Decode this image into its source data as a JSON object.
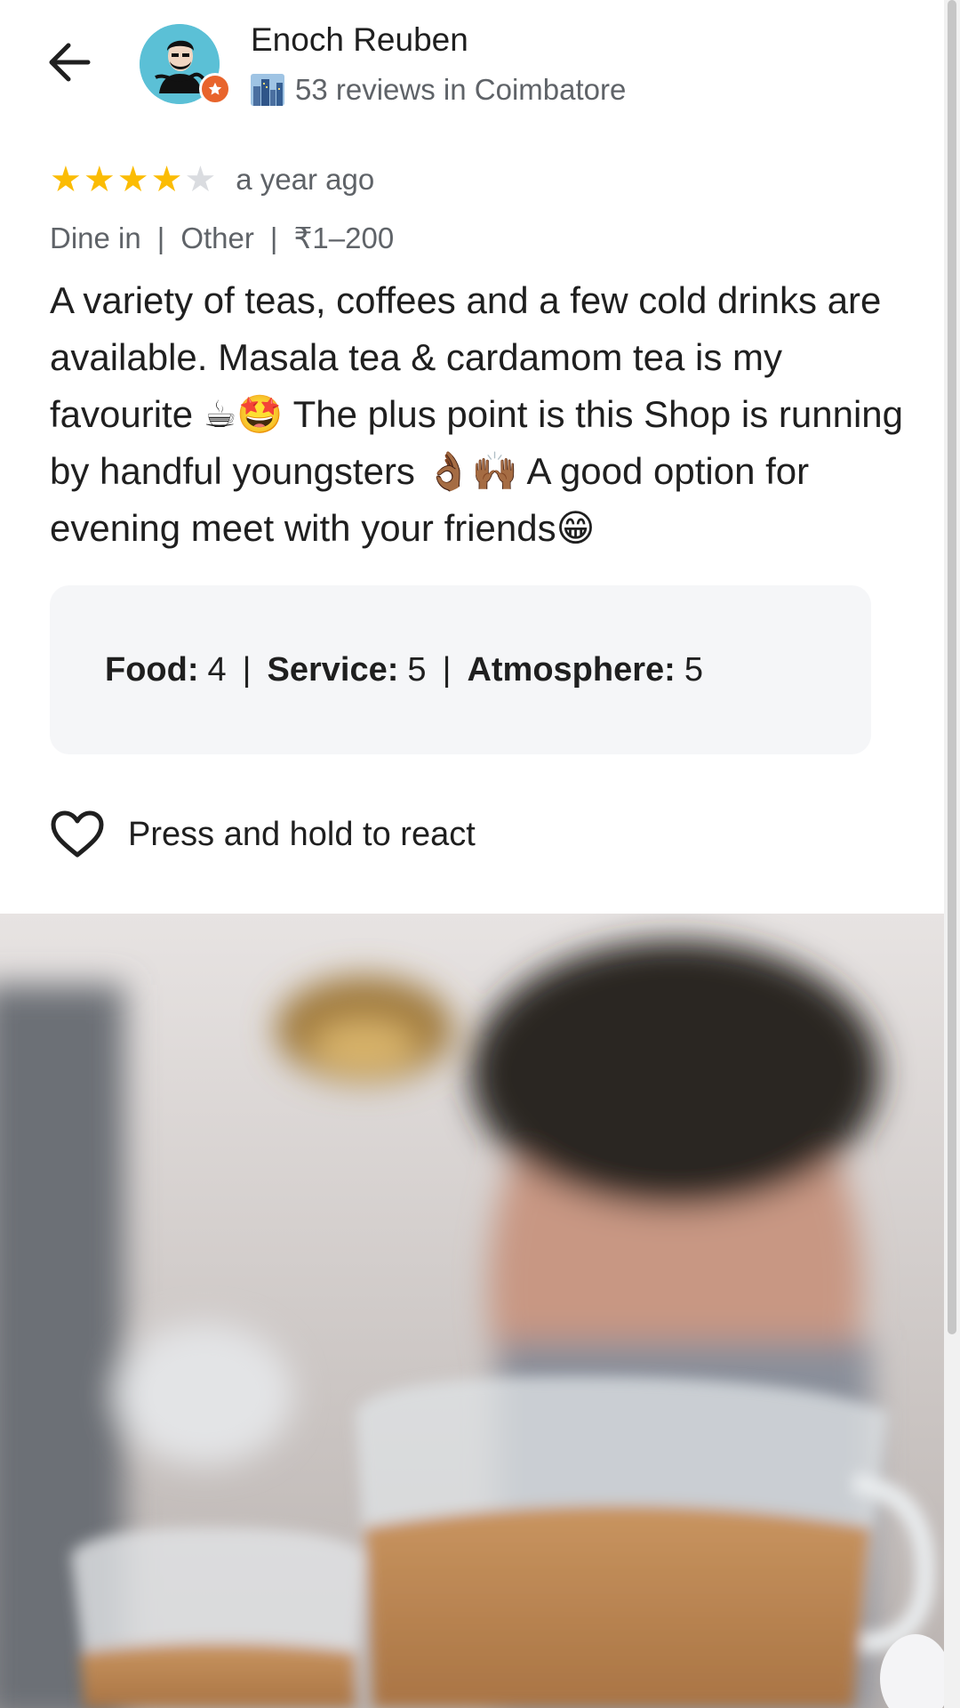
{
  "header": {
    "user_name": "Enoch Reuben",
    "user_subtitle": "53 reviews in Coimbatore",
    "back_icon": "arrow-back-icon",
    "badge_icon": "local-guide-star-icon",
    "city_icon": "cityscape-emoji-icon"
  },
  "review": {
    "rating": 4,
    "rating_max": 5,
    "stars": [
      "★",
      "★",
      "★",
      "★",
      "★"
    ],
    "time": "a year ago",
    "meta": {
      "service_type": "Dine in",
      "meal_type": "Other",
      "price": "₹1–200",
      "separator": "|"
    },
    "text": "A variety of teas, coffees and a few cold drinks are available. Masala tea & cardamom tea is my favourite ☕🤩 The plus point is this Shop is running by handful youngsters 👌🏾🙌🏾 A good option for evening meet with your friends😁"
  },
  "subratings": {
    "food_label": "Food:",
    "food_value": "4",
    "service_label": "Service:",
    "service_value": "5",
    "atmosphere_label": "Atmosphere:",
    "atmosphere_value": "5",
    "separator": "|"
  },
  "react": {
    "label": "Press and hold to react",
    "icon": "heart-outline-icon"
  },
  "colors": {
    "star_on": "#fbbc04",
    "star_off": "#dadce0",
    "badge": "#e8642c",
    "subratings_bg": "#f5f6f8",
    "secondary_text": "#5f6368"
  }
}
